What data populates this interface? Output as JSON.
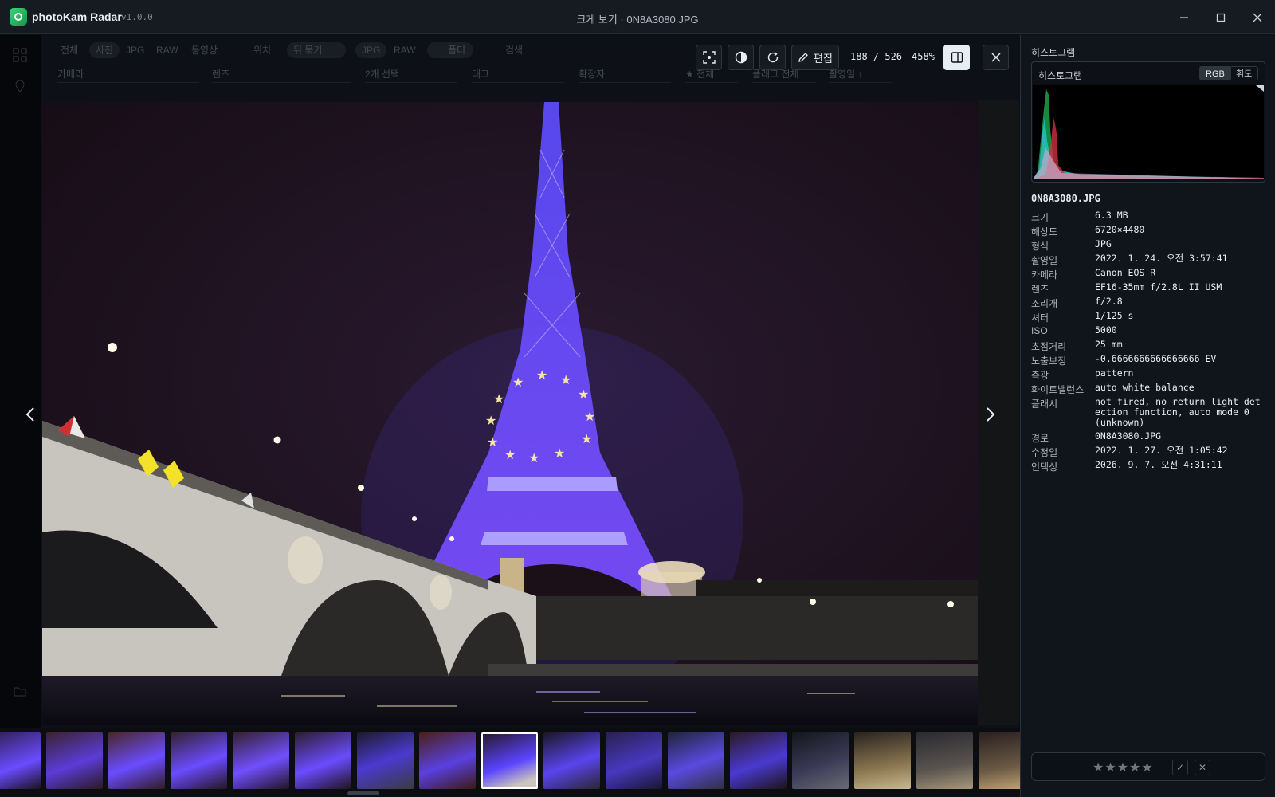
{
  "app": {
    "name": "photoKam Radar",
    "version": "v1.0.0"
  },
  "window": {
    "title": "크게 보기 · 0N8A3080.JPG"
  },
  "background_toolbar": {
    "chips": [
      "전체",
      "사진",
      "JPG",
      "RAW",
      "동영상",
      "위치",
      "뒤 묶기",
      "JPG",
      "RAW",
      "폴더",
      "검색"
    ],
    "selects": [
      "카메라",
      "렌즈",
      "2개 선택",
      "태그",
      "확장자",
      "★ 전체",
      "플래그 전체",
      "촬영일 ↑"
    ]
  },
  "viewer": {
    "counter": "188 / 526",
    "zoom": "458%",
    "edit_label": "편집",
    "icons": {
      "fit": "focus-frame-icon",
      "contrast": "contrast-icon",
      "rotate": "rotate-icon",
      "edit": "pencil-icon",
      "panel": "side-panel-icon",
      "close": "close-icon"
    }
  },
  "panel": {
    "title": "히스토그램",
    "histogram": {
      "label": "히스토그램",
      "modes": [
        "RGB",
        "휘도"
      ],
      "active_mode": "RGB"
    },
    "file_name": "0N8A3080.JPG",
    "metadata": [
      {
        "key": "크기",
        "value": "6.3 MB"
      },
      {
        "key": "해상도",
        "value": "6720×4480"
      },
      {
        "key": "형식",
        "value": "JPG"
      },
      {
        "key": "촬영일",
        "value": "2022. 1. 24. 오전 3:57:41"
      },
      {
        "key": "카메라",
        "value": "Canon EOS R"
      },
      {
        "key": "렌즈",
        "value": "EF16-35mm f/2.8L II USM"
      },
      {
        "key": "조리개",
        "value": "f/2.8"
      },
      {
        "key": "셔터",
        "value": "1/125 s"
      },
      {
        "key": "ISO",
        "value": "5000"
      },
      {
        "key": "초점거리",
        "value": "25 mm"
      },
      {
        "key": "노출보정",
        "value": "-0.6666666666666666 EV"
      },
      {
        "key": "측광",
        "value": "pattern"
      },
      {
        "key": "화이트밸런스",
        "value": "auto white balance"
      },
      {
        "key": "플래시",
        "value": "not fired, no return light detection function, auto mode 0 (unknown)"
      },
      {
        "key": "경로",
        "value": "0N8A3080.JPG"
      },
      {
        "key": "수정일",
        "value": "2022. 1. 27. 오전 1:05:42"
      },
      {
        "key": "인덱싱",
        "value": "2026. 9. 7. 오전 4:31:11"
      }
    ],
    "rating": {
      "stars": "★★★★★",
      "accept": "✓",
      "reject": "✕",
      "value": 0
    }
  },
  "filmstrip": {
    "count": 17,
    "selected_index": 8
  }
}
